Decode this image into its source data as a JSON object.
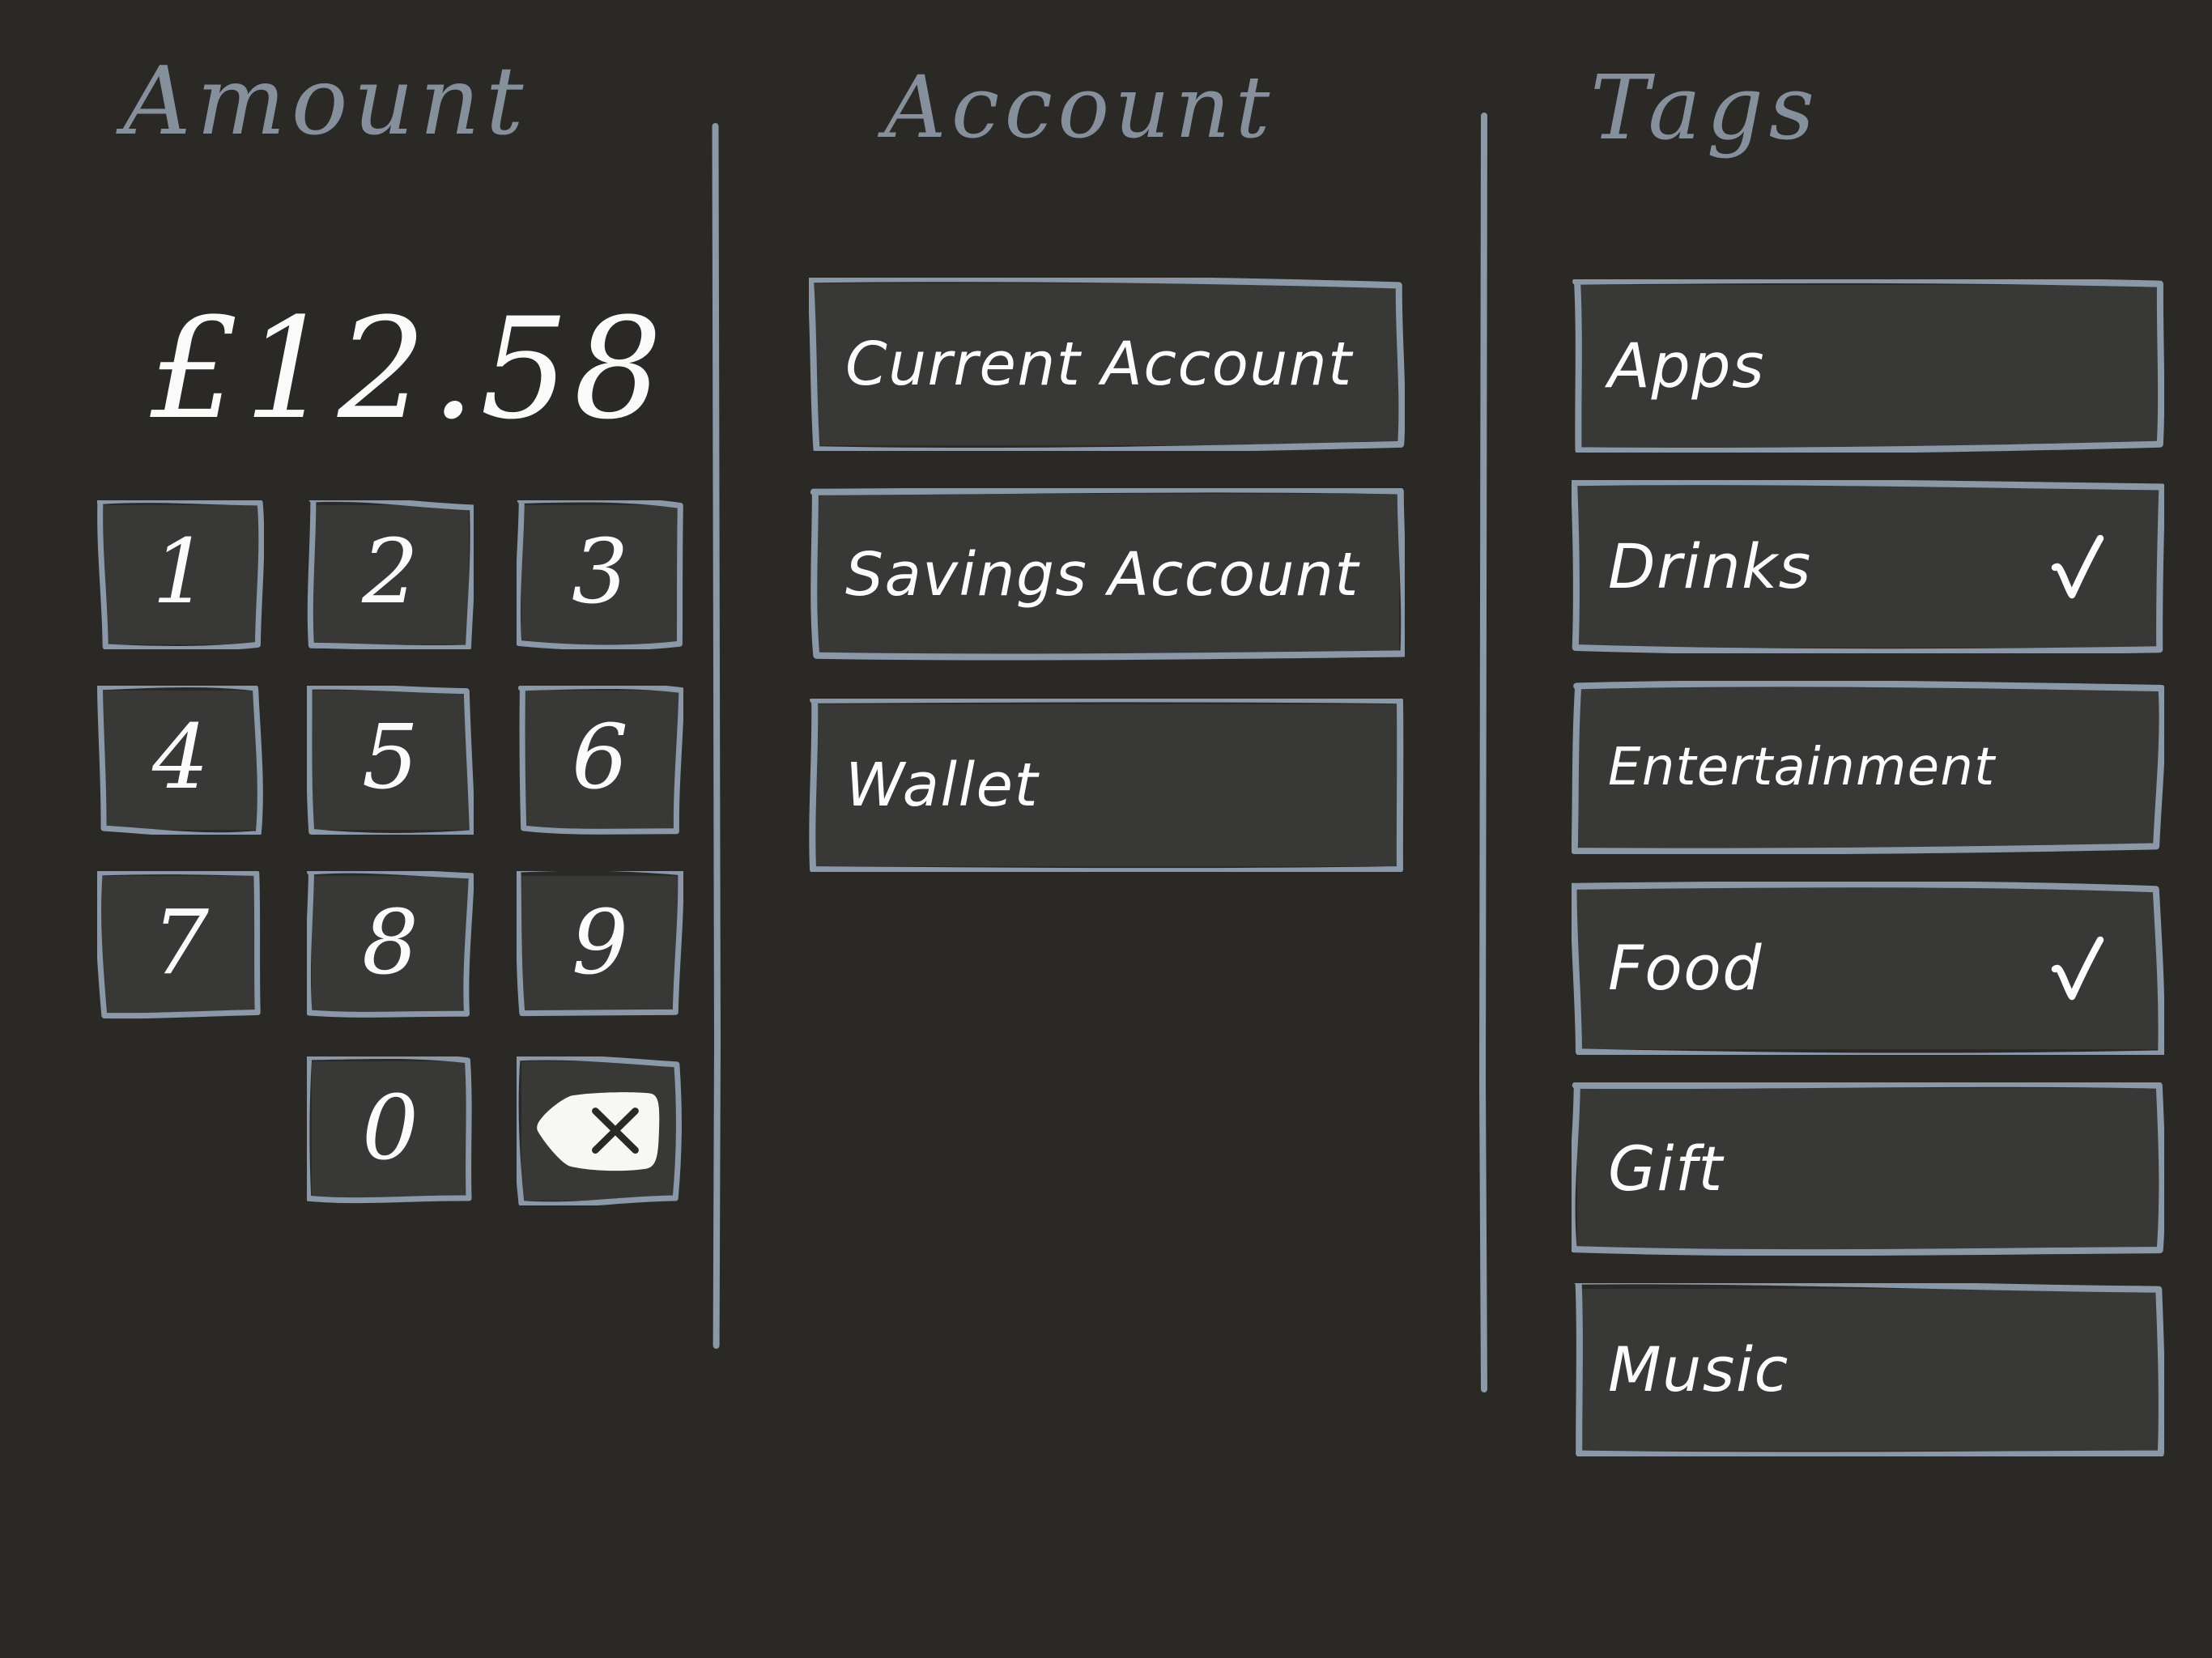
{
  "theme": {
    "background": "#2a2926",
    "panel_fill": "#383836",
    "stroke": "#8b98a8",
    "ink": "#fbfbfb",
    "header_ink": "#8e99a7"
  },
  "columns": {
    "amount": {
      "header": "Amount"
    },
    "account": {
      "header": "Account"
    },
    "tags": {
      "header": "Tags"
    }
  },
  "amount": {
    "display_value": "£12.58",
    "currency_symbol": "£",
    "numeric_value": "12.58"
  },
  "keypad": {
    "keys": [
      {
        "label": "1",
        "name": "key-1"
      },
      {
        "label": "2",
        "name": "key-2"
      },
      {
        "label": "3",
        "name": "key-3"
      },
      {
        "label": "4",
        "name": "key-4"
      },
      {
        "label": "5",
        "name": "key-5"
      },
      {
        "label": "6",
        "name": "key-6"
      },
      {
        "label": "7",
        "name": "key-7"
      },
      {
        "label": "8",
        "name": "key-8"
      },
      {
        "label": "9",
        "name": "key-9"
      },
      {
        "label": "0",
        "name": "key-0"
      }
    ],
    "backspace": {
      "icon": "backspace-delete-icon",
      "label": ""
    }
  },
  "accounts": {
    "items": [
      {
        "label": "Current Account",
        "selected": false
      },
      {
        "label": "Savings Account",
        "selected": false
      },
      {
        "label": "Wallet",
        "selected": false
      }
    ]
  },
  "tags": {
    "check_icon": "check-icon",
    "items": [
      {
        "label": "Apps",
        "checked": false
      },
      {
        "label": "Drinks",
        "checked": true
      },
      {
        "label": "Entertainment",
        "checked": false
      },
      {
        "label": "Food",
        "checked": true
      },
      {
        "label": "Gift",
        "checked": false
      },
      {
        "label": "Music",
        "checked": false
      }
    ]
  }
}
